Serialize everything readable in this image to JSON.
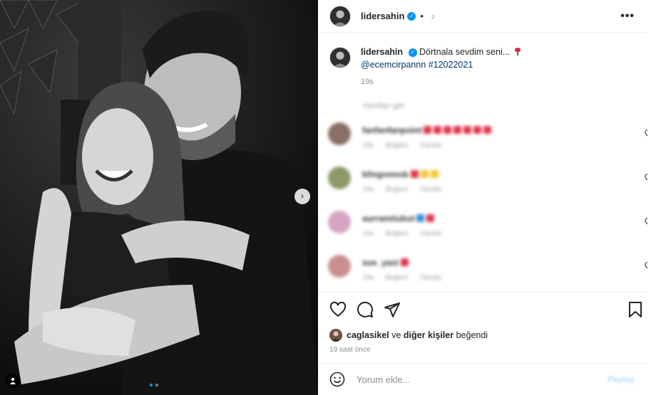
{
  "photo": {
    "alt_icon": "carousel-photo",
    "carousel_total": 2,
    "carousel_active": 1,
    "next_glyph": "›"
  },
  "header": {
    "username": "lidersahin",
    "verified_glyph": "✓",
    "separator": "•",
    "audio_glyph": "♪",
    "more_glyph": "•••"
  },
  "caption": {
    "username": "lidersahin",
    "text": "Dörtnala sevdim seni...",
    "mention": "@ecemcirpannn",
    "hashtag": "#12022021",
    "time": "19s"
  },
  "comments_header": "Yanıtları gör",
  "comments": [
    {
      "user": "fanfanfanpoint",
      "emojis": [
        "red",
        "red",
        "red",
        "red",
        "red",
        "red",
        "red"
      ],
      "meta": "19s Beğeni Yanıtla",
      "avatar_color": "#8a6f66"
    },
    {
      "user": "k0ngonnob",
      "emojis": [
        "red",
        "yellow",
        "yellow"
      ],
      "meta": "19s Beğeni Yanıtla",
      "avatar_color": "#8c9a6a"
    },
    {
      "user": "aurramiiubut",
      "emojis": [
        "blue",
        "red"
      ],
      "meta": "19s Beğeni Yanıtla",
      "avatar_color": "#d7a3c2"
    },
    {
      "user": "sue_yasi",
      "emojis": [
        "red"
      ],
      "meta": "19s Beğeni Yanıtla",
      "avatar_color": "#c98f8f"
    }
  ],
  "likes": {
    "user": "caglasikel",
    "connector": " ve ",
    "others": "diğer kişiler",
    "verb": " beğendi"
  },
  "posted_ago": "19 saat önce",
  "comment_box": {
    "placeholder": "Yorum ekle...",
    "post_label": "Paylaş"
  },
  "colors": {
    "verified_blue": "#0095f6",
    "mention_blue": "#00376b",
    "meta_gray": "#8e8e8e"
  }
}
